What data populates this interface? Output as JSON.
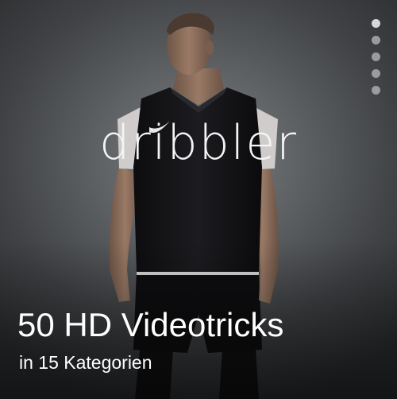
{
  "logo": {
    "text": "dribbler"
  },
  "pager": {
    "count": 5,
    "active_index": 0
  },
  "promo": {
    "headline": "50 HD Videotricks",
    "subline": "in 15 Kategorien"
  },
  "colors": {
    "background": "#404245",
    "text": "#ffffff",
    "dot": "#a9abad",
    "jersey": "#141416",
    "sleeve": "#cfcccb"
  },
  "icons": [
    "nike-swoosh-icon"
  ]
}
